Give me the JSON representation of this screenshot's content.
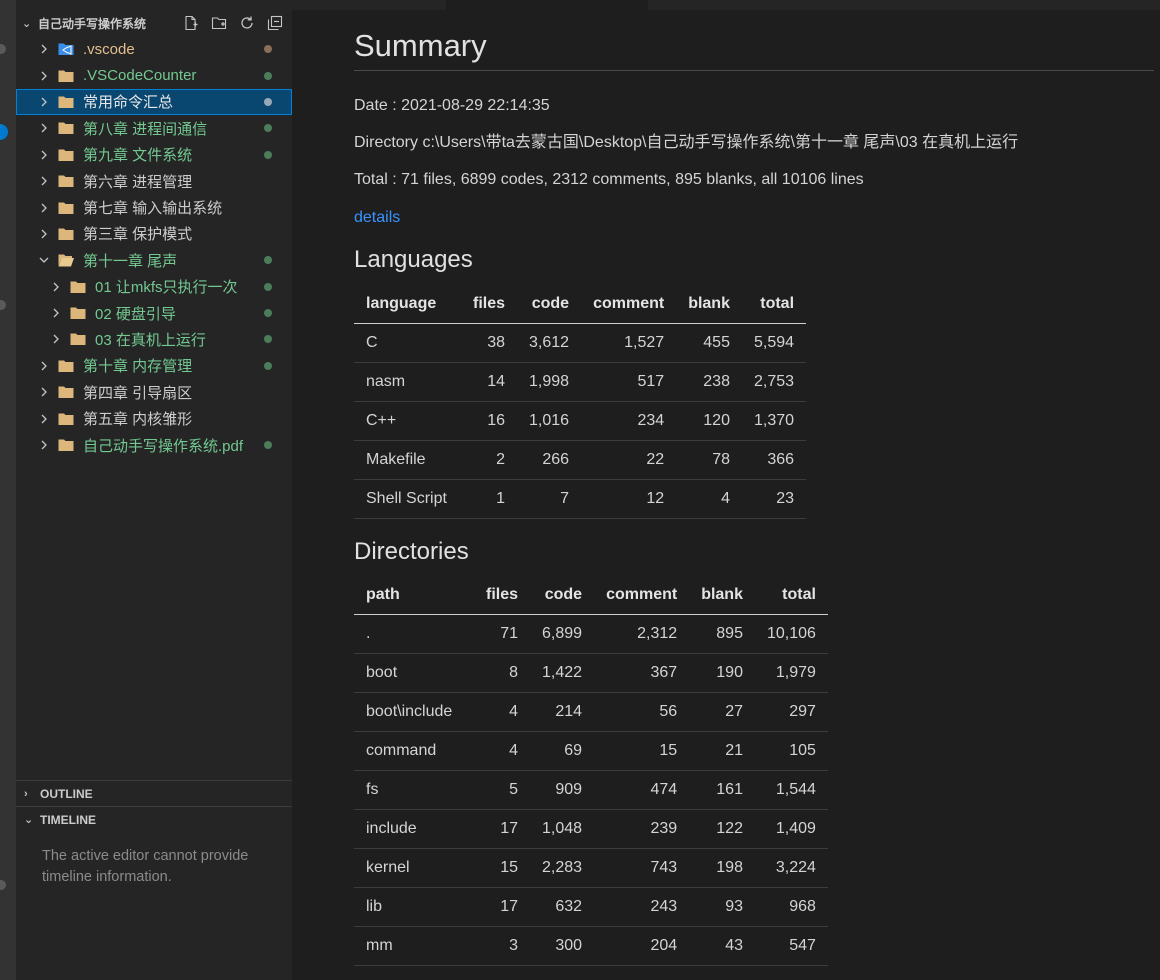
{
  "explorer": {
    "title": "自己动手写操作系统",
    "actions": [
      "new-file-icon",
      "new-folder-icon",
      "refresh-icon",
      "collapse-all-icon"
    ],
    "items": [
      {
        "label": ".vscode",
        "icon": "vscode-folder-icon",
        "color": "#e2c08d",
        "dot": "#8a6d5a",
        "level": 0,
        "expanded": false
      },
      {
        "label": ".VSCodeCounter",
        "icon": "folder-icon",
        "color": "#73c991",
        "dot": "#4b7d5a",
        "level": 0,
        "expanded": false
      },
      {
        "label": "常用命令汇总",
        "icon": "folder-icon",
        "color": "#e7e7e7",
        "dot": "#9aa9b8",
        "level": 0,
        "expanded": false,
        "selected": true
      },
      {
        "label": "第八章 进程间通信",
        "icon": "folder-icon",
        "color": "#73c991",
        "dot": "#4b7d5a",
        "level": 0,
        "expanded": false
      },
      {
        "label": "第九章 文件系统",
        "icon": "folder-icon",
        "color": "#73c991",
        "dot": "#4b7d5a",
        "level": 0,
        "expanded": false
      },
      {
        "label": "第六章 进程管理",
        "icon": "folder-icon",
        "color": "#cccccc",
        "dot": "",
        "level": 0,
        "expanded": false
      },
      {
        "label": "第七章 输入输出系统",
        "icon": "folder-icon",
        "color": "#cccccc",
        "dot": "",
        "level": 0,
        "expanded": false
      },
      {
        "label": "第三章 保护模式",
        "icon": "folder-icon",
        "color": "#cccccc",
        "dot": "",
        "level": 0,
        "expanded": false
      },
      {
        "label": "第十一章 尾声",
        "icon": "folder-open-icon",
        "color": "#73c991",
        "dot": "#4b7d5a",
        "level": 0,
        "expanded": true
      },
      {
        "label": "01 让mkfs只执行一次",
        "icon": "folder-icon",
        "color": "#73c991",
        "dot": "#4b7d5a",
        "level": 1,
        "expanded": false
      },
      {
        "label": "02 硬盘引导",
        "icon": "folder-icon",
        "color": "#73c991",
        "dot": "#4b7d5a",
        "level": 1,
        "expanded": false
      },
      {
        "label": "03 在真机上运行",
        "icon": "folder-icon",
        "color": "#73c991",
        "dot": "#4b7d5a",
        "level": 1,
        "expanded": false
      },
      {
        "label": "第十章 内存管理",
        "icon": "folder-icon",
        "color": "#73c991",
        "dot": "#4b7d5a",
        "level": 0,
        "expanded": false
      },
      {
        "label": "第四章 引导扇区",
        "icon": "folder-icon",
        "color": "#cccccc",
        "dot": "",
        "level": 0,
        "expanded": false
      },
      {
        "label": "第五章 内核雏形",
        "icon": "folder-icon",
        "color": "#cccccc",
        "dot": "",
        "level": 0,
        "expanded": false
      },
      {
        "label": "自己动手写操作系统.pdf",
        "icon": "folder-icon",
        "color": "#73c991",
        "dot": "#4b7d5a",
        "level": 0,
        "expanded": false
      }
    ]
  },
  "panels": {
    "outline": "OUTLINE",
    "timeline": "TIMELINE",
    "timeline_message": "The active editor cannot provide timeline information."
  },
  "doc": {
    "title": "Summary",
    "date": "Date : 2021-08-29 22:14:35",
    "directory": "Directory c:\\Users\\带ta去蒙古国\\Desktop\\自己动手写操作系统\\第十一章 尾声\\03 在真机上运行",
    "total": "Total : 71 files,  6899 codes, 2312 comments, 895 blanks, all 10106 lines",
    "details_link": "details",
    "languages_heading": "Languages",
    "languages_columns": [
      "language",
      "files",
      "code",
      "comment",
      "blank",
      "total"
    ],
    "languages_rows": [
      [
        "C",
        "38",
        "3,612",
        "1,527",
        "455",
        "5,594"
      ],
      [
        "nasm",
        "14",
        "1,998",
        "517",
        "238",
        "2,753"
      ],
      [
        "C++",
        "16",
        "1,016",
        "234",
        "120",
        "1,370"
      ],
      [
        "Makefile",
        "2",
        "266",
        "22",
        "78",
        "366"
      ],
      [
        "Shell Script",
        "1",
        "7",
        "12",
        "4",
        "23"
      ]
    ],
    "directories_heading": "Directories",
    "directories_columns": [
      "path",
      "files",
      "code",
      "comment",
      "blank",
      "total"
    ],
    "directories_rows": [
      [
        ".",
        "71",
        "6,899",
        "2,312",
        "895",
        "10,106"
      ],
      [
        "boot",
        "8",
        "1,422",
        "367",
        "190",
        "1,979"
      ],
      [
        "boot\\include",
        "4",
        "214",
        "56",
        "27",
        "297"
      ],
      [
        "command",
        "4",
        "69",
        "15",
        "21",
        "105"
      ],
      [
        "fs",
        "5",
        "909",
        "474",
        "161",
        "1,544"
      ],
      [
        "include",
        "17",
        "1,048",
        "239",
        "122",
        "1,409"
      ],
      [
        "kernel",
        "15",
        "2,283",
        "743",
        "198",
        "3,224"
      ],
      [
        "lib",
        "17",
        "632",
        "243",
        "93",
        "968"
      ],
      [
        "mm",
        "3",
        "300",
        "204",
        "43",
        "547"
      ]
    ]
  },
  "colors": {
    "folder": "#dcb67a",
    "vscode_folder": "#3b8eea",
    "link": "#3794ff",
    "selection": "#094771"
  }
}
